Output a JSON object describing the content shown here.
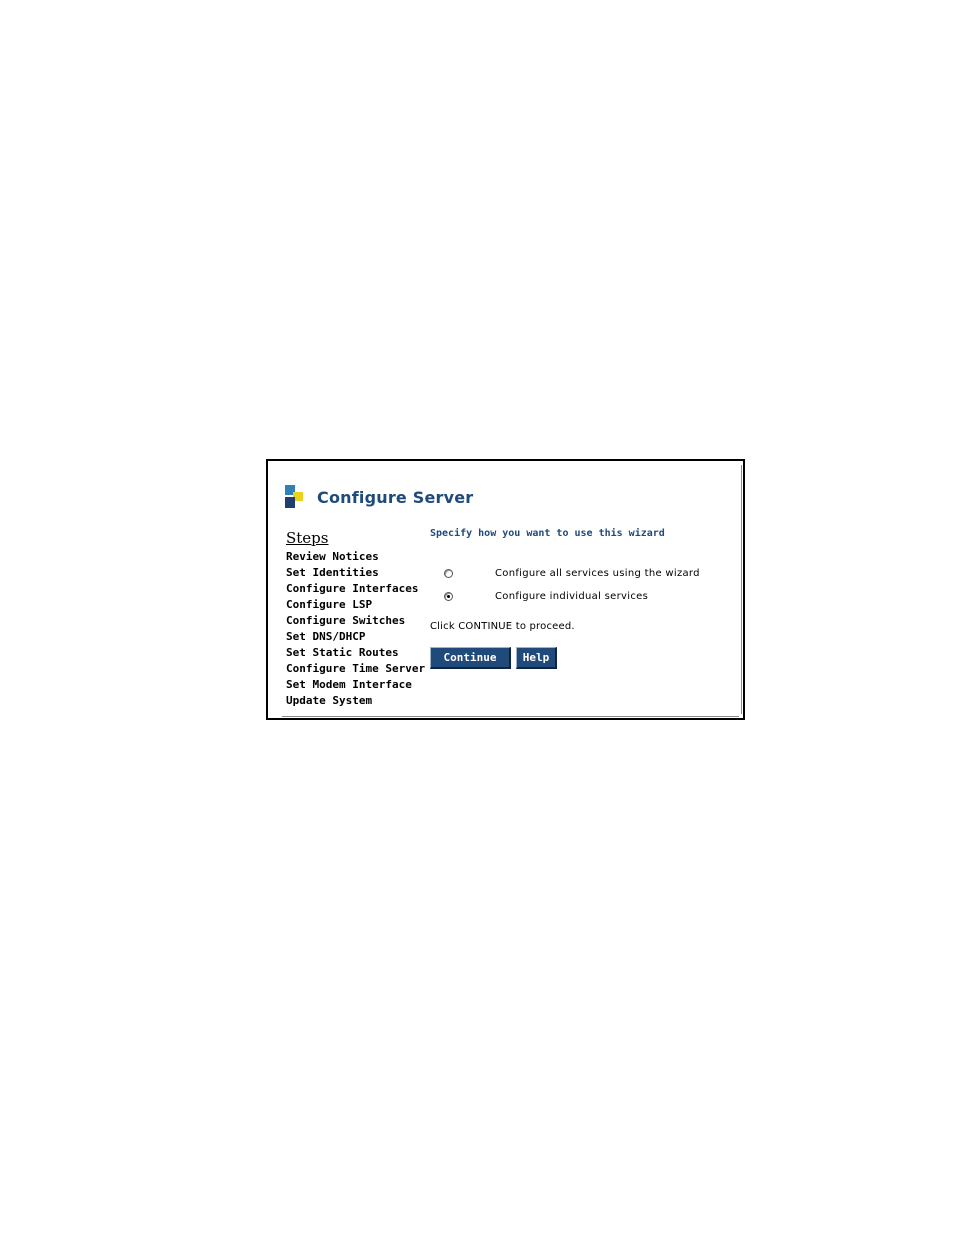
{
  "dialog": {
    "title": "Configure Server",
    "logo_colors": {
      "blue": "#2f7fb8",
      "yellow": "#e8d21c",
      "navy": "#1f3f6e"
    }
  },
  "steps": {
    "heading": "Steps",
    "items": [
      "Review Notices",
      "Set Identities",
      "Configure Interfaces",
      "Configure LSP",
      "Configure Switches",
      "Set DNS/DHCP",
      "Set Static Routes",
      "Configure Time Server",
      "Set Modem Interface",
      "Update System"
    ]
  },
  "main": {
    "prompt": "Specify how you want to use this wizard",
    "options": [
      {
        "label": "Configure all services using the wizard",
        "checked": false
      },
      {
        "label": "Configure individual services",
        "checked": true
      }
    ],
    "instruction": "Click CONTINUE to proceed.",
    "buttons": {
      "continue_label": "Continue",
      "help_label": "Help"
    }
  },
  "colors": {
    "accent": "#1f4a7a",
    "button_bg": "#1f4a7a"
  }
}
